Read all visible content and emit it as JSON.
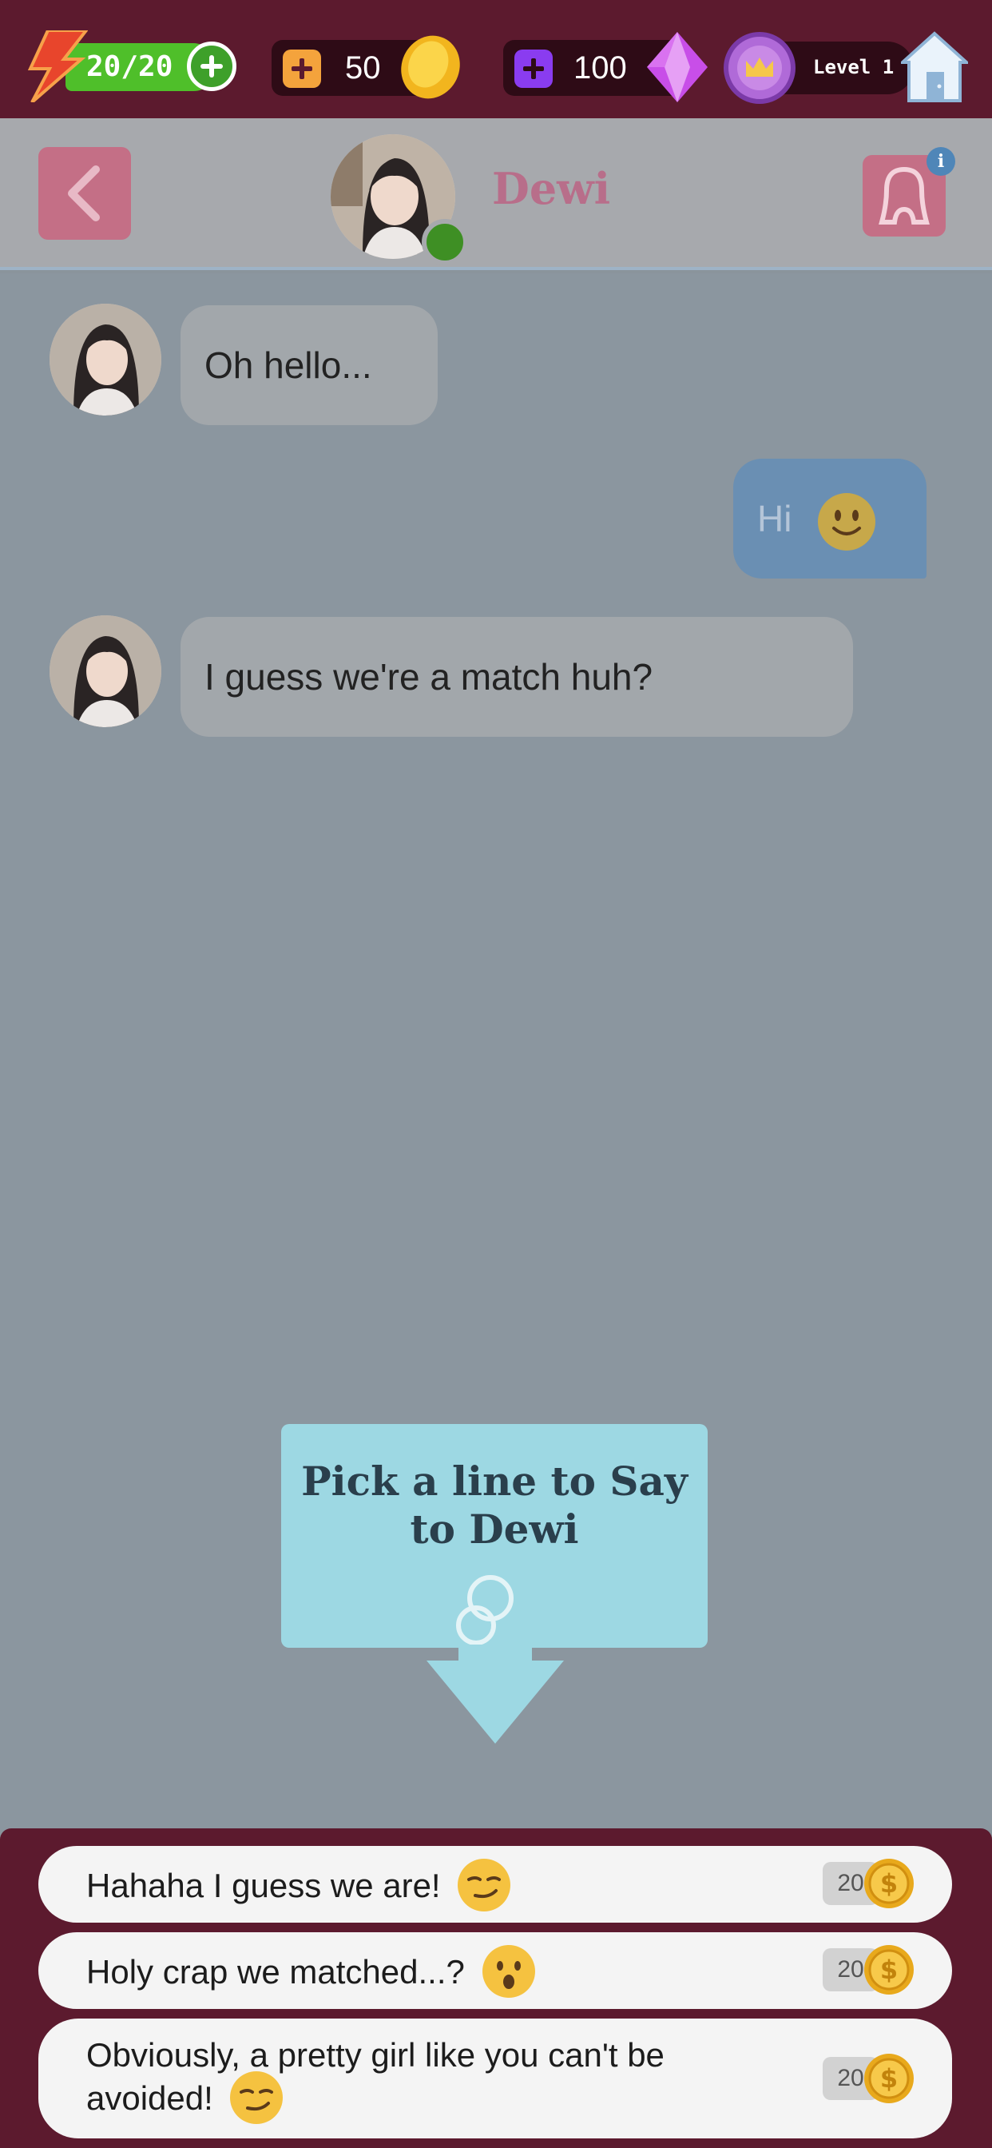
{
  "topbar": {
    "energy": "20/20",
    "coins": "50",
    "gems": "100",
    "level": "Level 1"
  },
  "header": {
    "name": "Dewi",
    "info_label": "i"
  },
  "messages": [
    {
      "from": "her",
      "text": "Oh hello..."
    },
    {
      "from": "me",
      "text": "Hi"
    },
    {
      "from": "her",
      "text": "I guess we're a match huh?"
    }
  ],
  "tutorial": {
    "line1": "Pick a line to Say",
    "line2": "to Dewi"
  },
  "choices": [
    {
      "line1": "Hahaha I guess we are!",
      "line2": "",
      "cost": "20",
      "emoji": "smirk-emoji"
    },
    {
      "line1": "Holy crap we matched...?",
      "line2": "",
      "cost": "20",
      "emoji": "surprised-emoji"
    },
    {
      "line1": "Obviously, a pretty girl like you can't be",
      "line2": "avoided!",
      "cost": "20",
      "emoji": "smirk-emoji"
    }
  ],
  "colors": {
    "topbar": "#5c1a2e",
    "chat_bg": "#8b969f",
    "accent_pink": "#c46f86",
    "tooltip": "#9dd8e3",
    "my_bubble": "#6a8fb3"
  }
}
